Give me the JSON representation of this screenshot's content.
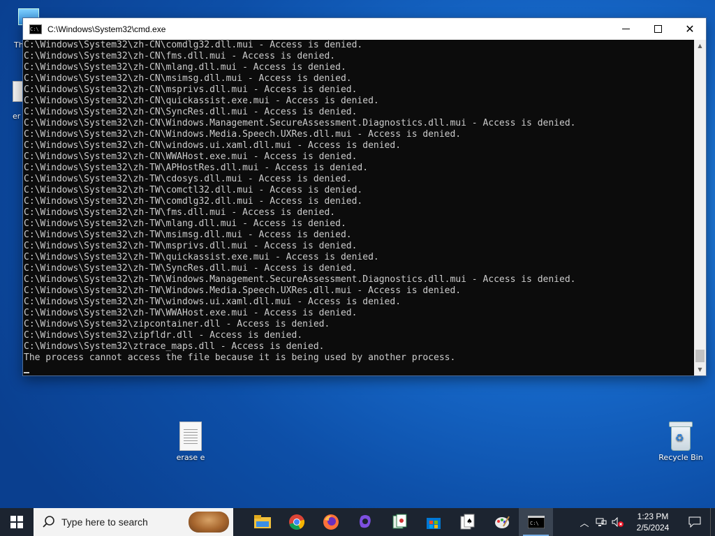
{
  "desktop": {
    "icons": [
      {
        "label": "erase e"
      },
      {
        "label": "Recycle Bin"
      }
    ],
    "partial_labels": [
      "Th",
      "er"
    ]
  },
  "window": {
    "title": "C:\\Windows\\System32\\cmd.exe",
    "app_icon_text": "C:\\",
    "console_lines": [
      "C:\\Windows\\System32\\zh-CN\\comdlg32.dll.mui - Access is denied.",
      "C:\\Windows\\System32\\zh-CN\\fms.dll.mui - Access is denied.",
      "C:\\Windows\\System32\\zh-CN\\mlang.dll.mui - Access is denied.",
      "C:\\Windows\\System32\\zh-CN\\msimsg.dll.mui - Access is denied.",
      "C:\\Windows\\System32\\zh-CN\\msprivs.dll.mui - Access is denied.",
      "C:\\Windows\\System32\\zh-CN\\quickassist.exe.mui - Access is denied.",
      "C:\\Windows\\System32\\zh-CN\\SyncRes.dll.mui - Access is denied.",
      "C:\\Windows\\System32\\zh-CN\\Windows.Management.SecureAssessment.Diagnostics.dll.mui - Access is denied.",
      "C:\\Windows\\System32\\zh-CN\\Windows.Media.Speech.UXRes.dll.mui - Access is denied.",
      "C:\\Windows\\System32\\zh-CN\\windows.ui.xaml.dll.mui - Access is denied.",
      "C:\\Windows\\System32\\zh-CN\\WWAHost.exe.mui - Access is denied.",
      "C:\\Windows\\System32\\zh-TW\\APHostRes.dll.mui - Access is denied.",
      "C:\\Windows\\System32\\zh-TW\\cdosys.dll.mui - Access is denied.",
      "C:\\Windows\\System32\\zh-TW\\comctl32.dll.mui - Access is denied.",
      "C:\\Windows\\System32\\zh-TW\\comdlg32.dll.mui - Access is denied.",
      "C:\\Windows\\System32\\zh-TW\\fms.dll.mui - Access is denied.",
      "C:\\Windows\\System32\\zh-TW\\mlang.dll.mui - Access is denied.",
      "C:\\Windows\\System32\\zh-TW\\msimsg.dll.mui - Access is denied.",
      "C:\\Windows\\System32\\zh-TW\\msprivs.dll.mui - Access is denied.",
      "C:\\Windows\\System32\\zh-TW\\quickassist.exe.mui - Access is denied.",
      "C:\\Windows\\System32\\zh-TW\\SyncRes.dll.mui - Access is denied.",
      "C:\\Windows\\System32\\zh-TW\\Windows.Management.SecureAssessment.Diagnostics.dll.mui - Access is denied.",
      "C:\\Windows\\System32\\zh-TW\\Windows.Media.Speech.UXRes.dll.mui - Access is denied.",
      "C:\\Windows\\System32\\zh-TW\\windows.ui.xaml.dll.mui - Access is denied.",
      "C:\\Windows\\System32\\zh-TW\\WWAHost.exe.mui - Access is denied.",
      "C:\\Windows\\System32\\zipcontainer.dll - Access is denied.",
      "C:\\Windows\\System32\\zipfldr.dll - Access is denied.",
      "C:\\Windows\\System32\\ztrace_maps.dll - Access is denied.",
      "The process cannot access the file because it is being used by another process."
    ]
  },
  "taskbar": {
    "search_placeholder": "Type here to search",
    "apps": [
      {
        "icon": "file-explorer-icon"
      },
      {
        "icon": "chrome-icon"
      },
      {
        "icon": "firefox-icon"
      },
      {
        "icon": "copilot-icon"
      },
      {
        "icon": "mahjong-icon"
      },
      {
        "icon": "store-icon"
      },
      {
        "icon": "solitaire-icon"
      },
      {
        "icon": "paint-icon"
      },
      {
        "icon": "cmd-icon",
        "active": true
      }
    ],
    "clock": {
      "time": "1:23 PM",
      "date": "2/5/2024"
    }
  },
  "colors": {
    "console_bg": "#0c0c0c",
    "console_fg": "#cccccc",
    "taskbar_bg": "#1c2430",
    "desktop_blue": "#1668c9"
  }
}
